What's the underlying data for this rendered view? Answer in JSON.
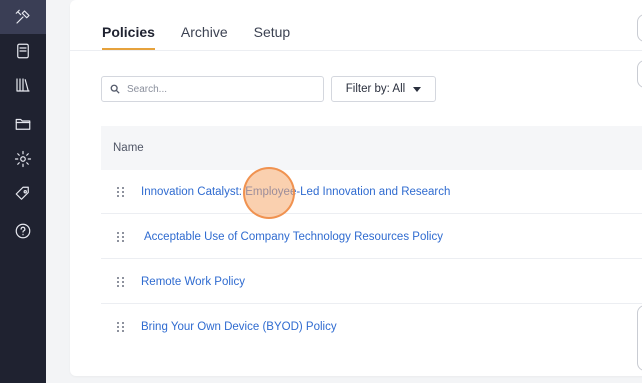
{
  "sidebar": {
    "items": [
      {
        "icon": "tools-icon",
        "active": true
      },
      {
        "icon": "document-icon",
        "active": false
      },
      {
        "icon": "library-icon",
        "active": false
      },
      {
        "icon": "folder-icon",
        "active": false
      },
      {
        "icon": "gear-icon",
        "active": false
      },
      {
        "icon": "tag-icon",
        "active": false
      },
      {
        "icon": "help-icon",
        "active": false
      }
    ]
  },
  "tabs": [
    {
      "label": "Policies",
      "active": true
    },
    {
      "label": "Archive",
      "active": false
    },
    {
      "label": "Setup",
      "active": false
    }
  ],
  "search": {
    "placeholder": "Search..."
  },
  "filter": {
    "label": "Filter by: All"
  },
  "table": {
    "header": "Name",
    "rows": [
      "Innovation Catalyst: Employee-Led Innovation and Research",
      "Acceptable Use of Company Technology Resources Policy",
      "Remote Work Policy",
      "Bring Your Own Device (BYOD) Policy"
    ]
  },
  "colors": {
    "sidebar": "#1f2230",
    "accent": "#e6a23c",
    "link": "#2f6bd0"
  }
}
